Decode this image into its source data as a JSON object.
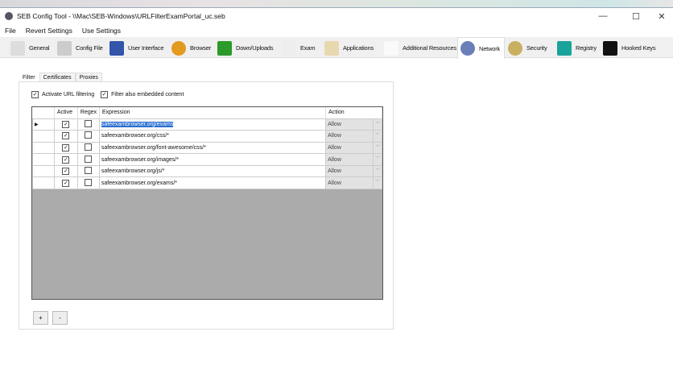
{
  "window": {
    "title": "SEB Config Tool - \\\\Mac\\SEB-Windows\\URLFilterExamPortal_uc.seb",
    "minimize": "—",
    "maximize": "☐",
    "close": "✕"
  },
  "menu": [
    "File",
    "Revert Settings",
    "Use Settings"
  ],
  "tabs": [
    {
      "label": "General",
      "icon": "general-icon",
      "color": "#ddd"
    },
    {
      "label": "Config File",
      "icon": "config-file-icon",
      "color": "#ccc"
    },
    {
      "label": "User Interface",
      "icon": "user-interface-icon",
      "color": "#3355aa"
    },
    {
      "label": "Browser",
      "icon": "browser-icon",
      "color": "#e39a20"
    },
    {
      "label": "Down/Uploads",
      "icon": "down-uploads-icon",
      "color": "#2a9a2a"
    },
    {
      "label": "Exam",
      "icon": "exam-icon",
      "color": "#eee"
    },
    {
      "label": "Applications",
      "icon": "applications-icon",
      "color": "#e8d8b0"
    },
    {
      "label": "Additional Resources",
      "icon": "additional-resources-icon",
      "color": "#fafafa"
    },
    {
      "label": "Network",
      "icon": "network-icon",
      "color": "#6a7fb8"
    },
    {
      "label": "Security",
      "icon": "security-icon",
      "color": "#c8b060"
    },
    {
      "label": "Registry",
      "icon": "registry-icon",
      "color": "#1aa39a"
    },
    {
      "label": "Hooked Keys",
      "icon": "hooked-keys-icon",
      "color": "#111"
    }
  ],
  "subtabs": [
    "Filter",
    "Certificates",
    "Proxies"
  ],
  "options": {
    "activate_url_filtering": "Activate URL filtering",
    "filter_embedded": "Filter also embedded content"
  },
  "grid": {
    "headers": [
      "Active",
      "Regex",
      "Expression",
      "Action"
    ],
    "rows": [
      {
        "expression": "safeexambrowser.org/exams",
        "action": "Allow"
      },
      {
        "expression": "safeexambrowser.org/css/*",
        "action": "Allow"
      },
      {
        "expression": "safeexambrowser.org/font-awesome/css/*",
        "action": "Allow"
      },
      {
        "expression": "safeexambrowser.org/images/*",
        "action": "Allow"
      },
      {
        "expression": "safeexambrowser.org/js/*",
        "action": "Allow"
      },
      {
        "expression": "safeexambrowser.org/exams/*",
        "action": "Allow"
      }
    ]
  },
  "buttons": {
    "add": "+",
    "remove": "-"
  }
}
